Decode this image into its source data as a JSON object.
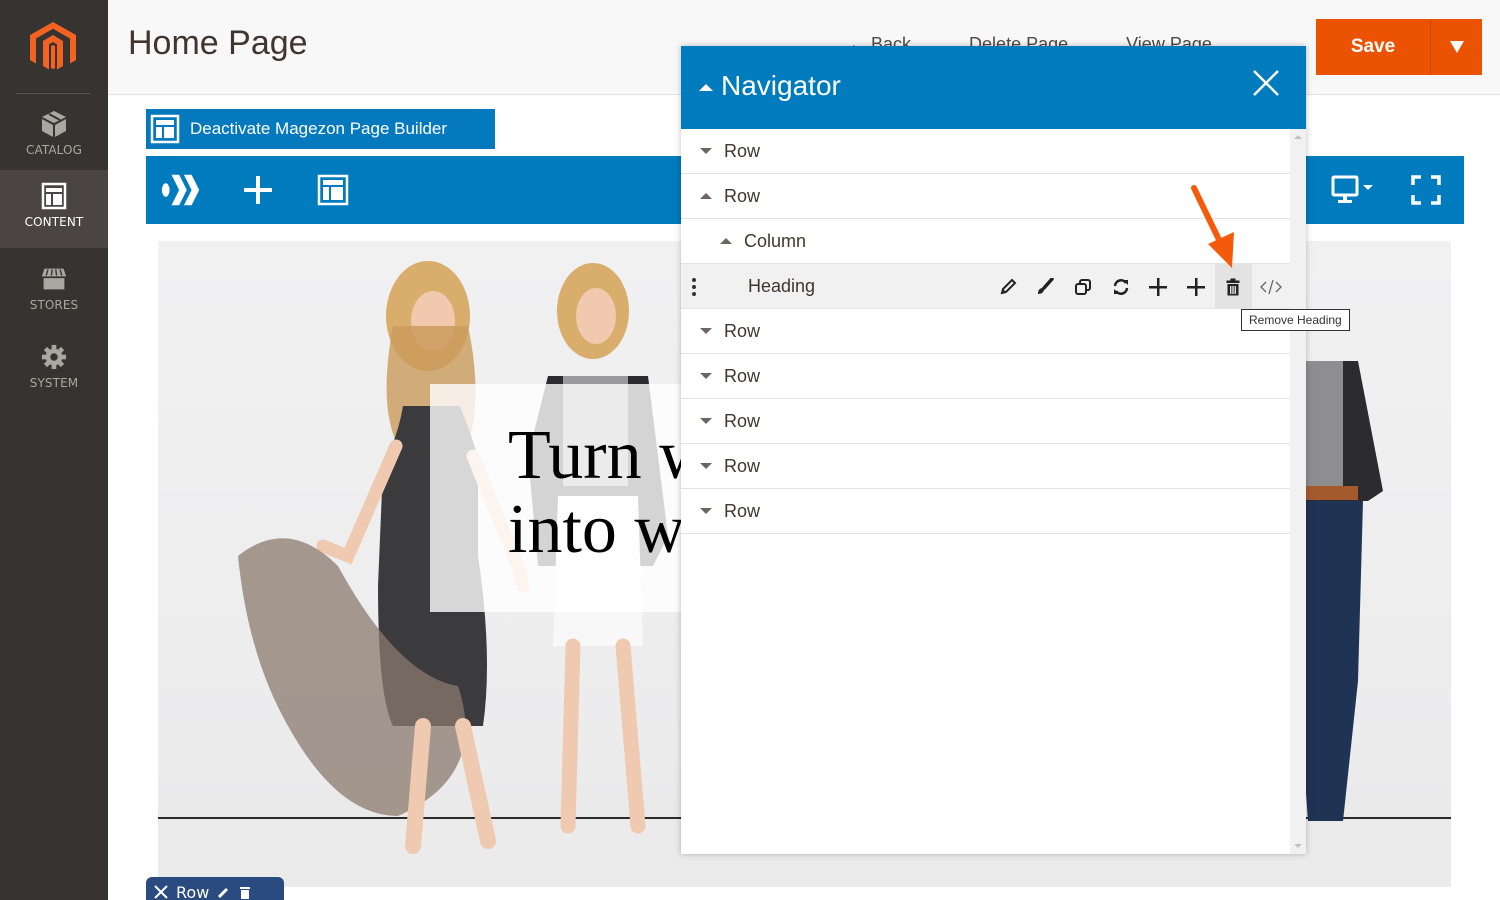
{
  "sidebar": {
    "logo": "magento-logo",
    "items": [
      {
        "label": "CATALOG",
        "icon": "cube-icon",
        "active": false
      },
      {
        "label": "CONTENT",
        "icon": "layout-icon",
        "active": true
      },
      {
        "label": "STORES",
        "icon": "storefront-icon",
        "active": false
      },
      {
        "label": "SYSTEM",
        "icon": "gear-icon",
        "active": false
      }
    ]
  },
  "header": {
    "title": "Home Page",
    "back_label": "Back",
    "delete_label": "Delete Page",
    "view_label": "View Page",
    "save_label": "Save",
    "save_menu_icon": "caret-down-icon"
  },
  "builder": {
    "deactivate_label": "Deactivate Magezon Page Builder",
    "toolbar": {
      "left": [
        "magezon-logo-icon",
        "plus-icon",
        "layout-icon"
      ],
      "right": [
        "desktop-icon",
        "fullscreen-icon"
      ]
    },
    "hero": {
      "heading": "Turn w\ninto w"
    },
    "row_tag_label": "Row"
  },
  "navigator": {
    "title": "Navigator",
    "items": [
      {
        "label": "Row",
        "expanded": false,
        "level": 0
      },
      {
        "label": "Row",
        "expanded": true,
        "level": 0
      },
      {
        "label": "Column",
        "expanded": true,
        "level": 1
      },
      {
        "label": "Heading",
        "level": 2,
        "selected": true
      },
      {
        "label": "Row",
        "expanded": false,
        "level": 0
      },
      {
        "label": "Row",
        "expanded": false,
        "level": 0
      },
      {
        "label": "Row",
        "expanded": false,
        "level": 0
      },
      {
        "label": "Row",
        "expanded": false,
        "level": 0
      },
      {
        "label": "Row",
        "expanded": false,
        "level": 0
      }
    ],
    "heading_actions": [
      "edit",
      "style",
      "duplicate",
      "replace",
      "add-before",
      "add-after",
      "remove",
      "code"
    ],
    "tooltip": "Remove Heading"
  },
  "colors": {
    "sidebar_bg": "#373330",
    "accent_orange": "#eb5202",
    "builder_blue": "#007bbd",
    "row_tag_blue": "#2a4b80"
  }
}
